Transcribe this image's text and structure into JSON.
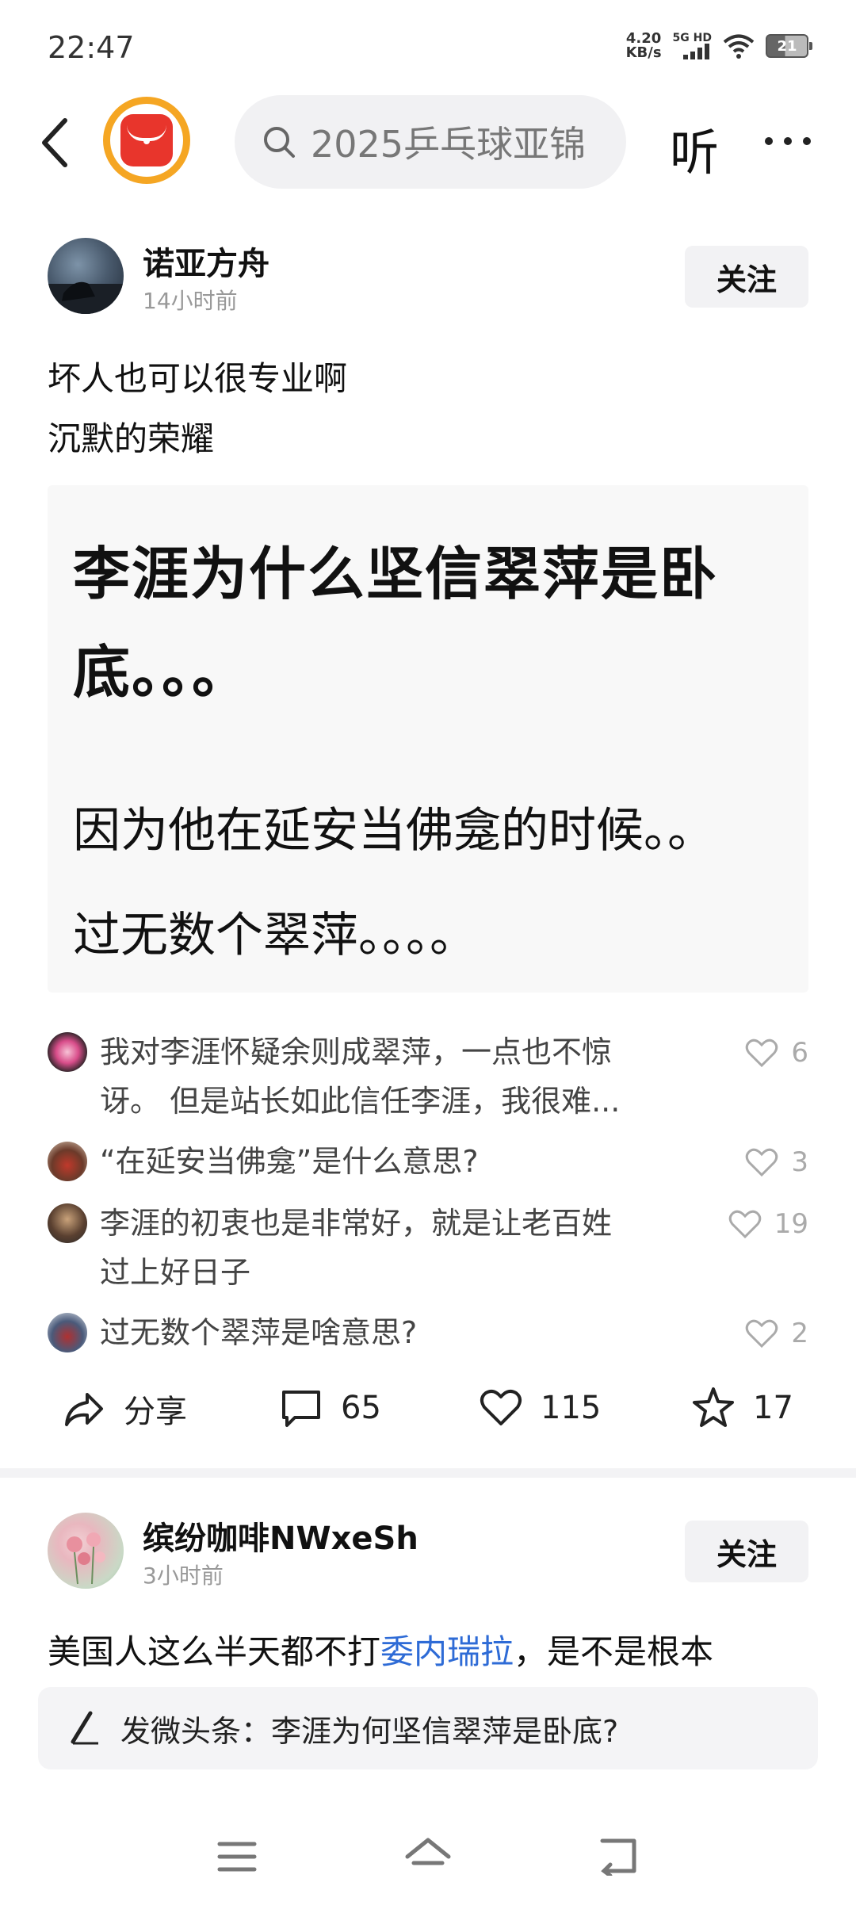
{
  "status_bar": {
    "time": "22:47",
    "net_speed_value": "4.20",
    "net_speed_unit": "KB/s",
    "network": "5G HD",
    "battery": "21"
  },
  "top_nav": {
    "search_text": "2025乒乓球亚锦",
    "listen_label": "听",
    "more_label": "···"
  },
  "post1": {
    "author": "诺亚方舟",
    "time": "14小时前",
    "follow_label": "关注",
    "text_lines": [
      "坏人也可以很专业啊",
      "沉默的荣耀"
    ],
    "image": {
      "headline": "李涯为什么坚信翠萍是卧底。。。",
      "body_line1": "因为他在延安当佛龛的时候。。",
      "body_line2": "过无数个翠萍。。。。"
    },
    "comments": [
      {
        "text_line1": "我对李涯怀疑余则成翠萍，一点也不惊",
        "text_line2": "讶。 但是站长如此信任李涯，我很难...",
        "likes": "6"
      },
      {
        "text_line1": "“在延安当佛龛”是什么意思?",
        "text_line2": "",
        "likes": "3"
      },
      {
        "text_line1": "李涯的初衷也是非常好，就是让老百姓",
        "text_line2": "过上好日子",
        "likes": "19"
      },
      {
        "text_line1": "过无数个翠萍是啥意思?",
        "text_line2": "",
        "likes": "2"
      }
    ],
    "actions": {
      "share_label": "分享",
      "comment_count": "65",
      "like_count": "115",
      "favorite_count": "17"
    }
  },
  "post2": {
    "author": "缤纷咖啡NWxeSh",
    "time": "3小时前",
    "follow_label": "关注",
    "text_before": "美国人这么半天都不打",
    "text_link": "委内瑞拉",
    "text_after": "，是不是根本"
  },
  "compose": {
    "label": "发微头条：李涯为何坚信翠萍是卧底?"
  },
  "colors": {
    "link": "#2e6bd6",
    "logo_ring": "#f5a623",
    "logo_core": "#e8352c"
  }
}
